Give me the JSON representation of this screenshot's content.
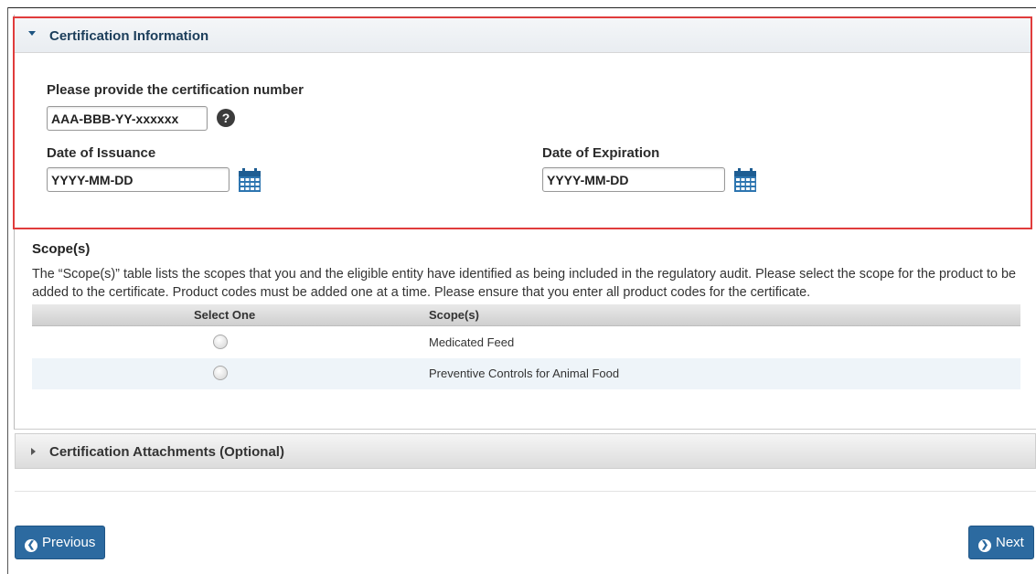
{
  "certification_section": {
    "title": "Certification Information",
    "cert_number": {
      "label": "Please provide the certification number",
      "value": "AAA-BBB-YY-xxxxxx",
      "help_glyph": "?"
    },
    "date_issuance": {
      "label": "Date of Issuance",
      "value": "YYYY-MM-DD"
    },
    "date_expiration": {
      "label": "Date of Expiration",
      "value": "YYYY-MM-DD"
    }
  },
  "scopes": {
    "title": "Scope(s)",
    "description": "The “Scope(s)” table lists the scopes that you and the eligible entity have identified as being included in the regulatory audit. Please select the scope for the product to be added to the certificate. Product codes must be added one at a time. Please ensure that you enter all product codes for the certificate.",
    "columns": [
      "Select One",
      "Scope(s)"
    ],
    "rows": [
      {
        "scope": "Medicated Feed",
        "selected": false
      },
      {
        "scope": "Preventive Controls for Animal Food",
        "selected": false
      }
    ]
  },
  "attachments_section": {
    "title": "Certification Attachments (Optional)"
  },
  "nav": {
    "previous_label": "Previous",
    "next_label": "Next"
  },
  "colors": {
    "accent": "#2c6aa0",
    "highlight_border": "#e03c3c",
    "row_alt": "#eef4f9"
  },
  "icons": [
    "caret-down-icon",
    "help-icon",
    "calendar-icon",
    "caret-right-icon",
    "chevron-left-icon",
    "chevron-right-icon"
  ]
}
